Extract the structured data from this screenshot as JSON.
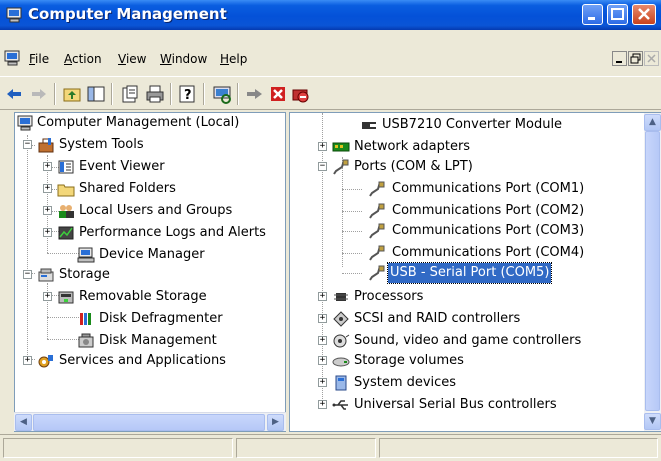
{
  "window": {
    "title": "Computer Management"
  },
  "menu": [
    {
      "label": "File",
      "underline": "F"
    },
    {
      "label": "Action",
      "underline": "A"
    },
    {
      "label": "View",
      "underline": "V"
    },
    {
      "label": "Window",
      "underline": "W"
    },
    {
      "label": "Help",
      "underline": "H"
    }
  ],
  "left_tree": {
    "root": "Computer Management (Local)",
    "system_tools": "System Tools",
    "event_viewer": "Event Viewer",
    "shared_folders": "Shared Folders",
    "local_users": "Local Users and Groups",
    "perf_logs": "Performance Logs and Alerts",
    "device_manager": "Device Manager",
    "storage": "Storage",
    "removable_storage": "Removable Storage",
    "disk_defrag": "Disk Defragmenter",
    "disk_management": "Disk Management",
    "services": "Services and Applications"
  },
  "right_tree": {
    "usb7210": "USB7210 Converter Module",
    "network_adapters": "Network adapters",
    "ports": "Ports (COM & LPT)",
    "com1": "Communications Port (COM1)",
    "com2": "Communications Port (COM2)",
    "com3": "Communications Port (COM3)",
    "com4": "Communications Port (COM4)",
    "com5": "USB - Serial Port (COM5)",
    "processors": "Processors",
    "scsi": "SCSI and RAID controllers",
    "sound": "Sound, video and game controllers",
    "storage_volumes": "Storage volumes",
    "system_devices": "System devices",
    "usb_controllers": "Universal Serial Bus controllers"
  },
  "icons": {
    "title": "computer-management-icon",
    "back": "back-arrow-icon",
    "forward": "forward-arrow-icon",
    "up": "up-folder-icon",
    "show_hide_tree": "show-hide-tree-icon",
    "properties": "properties-icon",
    "print": "print-icon",
    "help": "help-icon",
    "scan": "scan-hardware-icon",
    "update_driver": "update-driver-icon",
    "uninstall": "uninstall-icon",
    "disable": "disable-device-icon"
  },
  "colors": {
    "title_bar": "#0451d8",
    "selection": "#316ac5",
    "window_face": "#ece9d8"
  }
}
